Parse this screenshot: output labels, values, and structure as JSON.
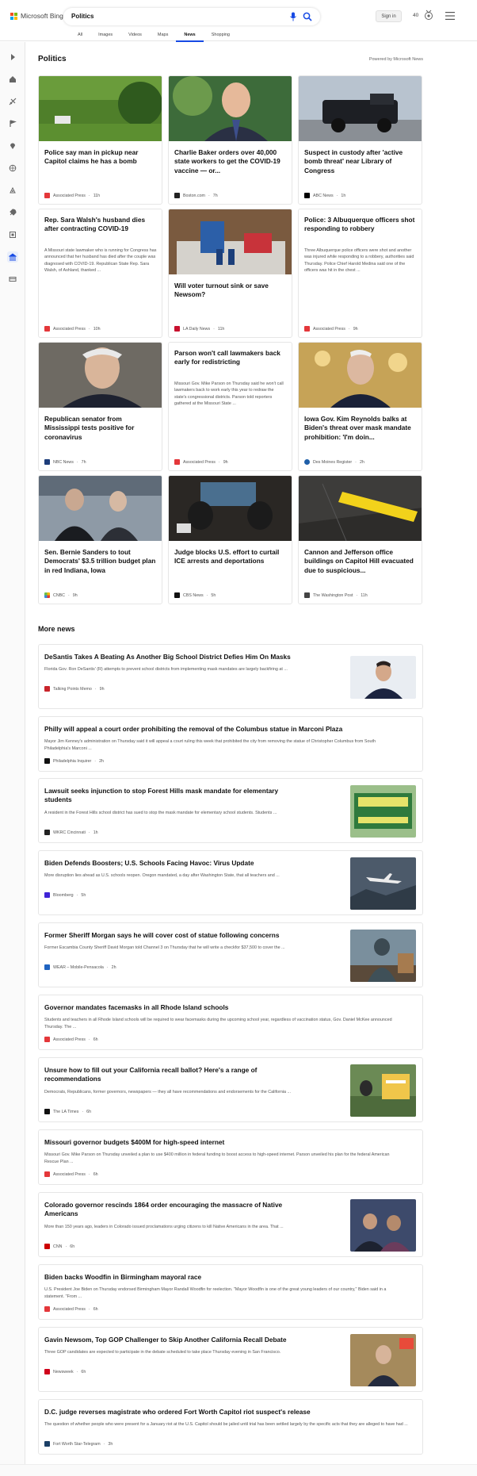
{
  "header": {
    "brand": "Microsoft Bing",
    "query": "Politics",
    "signin": "Sign in",
    "points": "40",
    "tabs": [
      "All",
      "Images",
      "Videos",
      "Maps",
      "News",
      "Shopping"
    ],
    "active_tab": "News",
    "logo_colors": [
      "#f25022",
      "#7fba00",
      "#00a4ef",
      "#ffb900"
    ],
    "accent": "#174ae4"
  },
  "rail": {
    "icons": [
      "expand-icon",
      "home-icon",
      "sports-icon",
      "flag-icon",
      "location-icon",
      "globe-icon",
      "science-icon",
      "rocket-icon",
      "entertainment-icon",
      "politics-icon",
      "money-icon"
    ]
  },
  "section": {
    "title": "Politics",
    "powered": "Powered by Microsoft News"
  },
  "cards": [
    {
      "title": "Police say man in pickup near Capitol claims he has a bomb",
      "source": "Associated Press",
      "time": "11h"
    },
    {
      "title": "Charlie Baker orders over 40,000 state workers to get the COVID-19 vaccine — or...",
      "source": "Boston.com",
      "time": "7h"
    },
    {
      "title": "Suspect in custody after 'active bomb threat' near Library of Congress",
      "source": "ABC News",
      "time": "1h"
    },
    {
      "title": "Rep. Sara Walsh's husband dies after contracting COVID-19",
      "snippet": "A Missouri state lawmaker who is running for Congress has announced that her husband has died after the couple was diagnosed with COVID-19. Republican State Rep. Sara Walsh, of Ashland, thanked ...",
      "source": "Associated Press",
      "time": "10h"
    },
    {
      "title": "Will voter turnout sink or save Newsom?",
      "source": "LA Daily News",
      "time": "11h"
    },
    {
      "title": "Police: 3 Albuquerque officers shot responding to robbery",
      "snippet": "Three Albuquerque police officers were shot and another was injured while responding to a robbery, authorities said Thursday. Police Chief Harold Medina said one of the officers was hit in the chest ...",
      "source": "Associated Press",
      "time": "9h"
    },
    {
      "title": "Republican senator from Mississippi tests positive for coronavirus",
      "source": "NBC News",
      "time": "7h"
    },
    {
      "title": "Parson won't call lawmakers back early for redistricting",
      "snippet": "Missouri Gov. Mike Parson on Thursday said he won't call lawmakers back to work early this year to redraw the state's congressional districts. Parson told reporters gathered at the Missouri State ...",
      "source": "Associated Press",
      "time": "9h"
    },
    {
      "title": "Iowa Gov. Kim Reynolds balks at Biden's threat over mask mandate prohibition: 'I'm doin...",
      "source": "Des Moines Register",
      "time": "2h"
    },
    {
      "title": "Sen. Bernie Sanders to tout Democrats' $3.5 trillion budget plan in red Indiana, Iowa",
      "source": "CNBC",
      "time": "9h"
    },
    {
      "title": "Judge blocks U.S. effort to curtail ICE arrests and deportations",
      "source": "CBS News",
      "time": "5h"
    },
    {
      "title": "Cannon and Jefferson office buildings on Capitol Hill evacuated due to suspicious...",
      "source": "The Washington Post",
      "time": "11h"
    }
  ],
  "more": {
    "title": "More news",
    "items": [
      {
        "title": "DeSantis Takes A Beating As Another Big School District Defies Him On Masks",
        "snippet": "Florida Gov. Ron DeSantis' (R) attempts to prevent school districts from implementing mask mandates are largely backfiring at ...",
        "source": "Talking Points Memo",
        "time": "9h"
      },
      {
        "title": "Philly will appeal a court order prohibiting the removal of the Columbus statue in Marconi Plaza",
        "snippet": "Mayor Jim Kenney's administration on Thursday said it will appeal a court ruling this week that prohibited the city from removing the statue of Christopher Columbus from South Philadelphia's Marconi ...",
        "source": "Philadelphia Inquirer",
        "time": "2h"
      },
      {
        "title": "Lawsuit seeks injunction to stop Forest Hills mask mandate for elementary students",
        "snippet": "A resident in the Forest Hills school district has sued to stop the mask mandate for elementary school students. Students ...",
        "source": "WKRC Cincinnati",
        "time": "1h"
      },
      {
        "title": "Biden Defends Boosters; U.S. Schools Facing Havoc: Virus Update",
        "snippet": "More disruption lies ahead as U.S. schools reopen. Oregon mandated, a day after Washington State, that all teachers and ...",
        "source": "Bloomberg",
        "time": "5h"
      },
      {
        "title": "Former Sheriff Morgan says he will cover cost of statue following concerns",
        "snippet": "Former Escambia County Sheriff David Morgan told Channel 3 on Thursday that he will write a checkfor $37,500 to cover the ...",
        "source": "WEAR – Mobile-Pensacola",
        "time": "2h"
      },
      {
        "title": "Governor mandates facemasks in all Rhode Island schools",
        "snippet": "Students and teachers in all Rhode Island schools will be required to wear facemasks during the upcoming school year, regardless of vaccination status, Gov. Daniel McKee announced Thursday. The ...",
        "source": "Associated Press",
        "time": "6h"
      },
      {
        "title": "Unsure how to fill out your California recall ballot? Here's a range of recommendations",
        "snippet": "Democrats, Republicans, former governors, newspapers — they all have recommendations and endorsements for the California ...",
        "source": "The LA Times",
        "time": "6h"
      },
      {
        "title": "Missouri governor budgets $400M for high-speed internet",
        "snippet": "Missouri Gov. Mike Parson on Thursday unveiled a plan to use $400 million in federal funding to boost access to high-speed internet. Parson unveiled his plan for the federal American Rescue Plan ...",
        "source": "Associated Press",
        "time": "6h"
      },
      {
        "title": "Colorado governor rescinds 1864 order encouraging the massacre of Native Americans",
        "snippet": "More than 150 years ago, leaders in Colorado issued proclamations urging citizens to kill Native Americans in the area. That ...",
        "source": "CNN",
        "time": "6h"
      },
      {
        "title": "Biden backs Woodfin in Birmingham mayoral race",
        "snippet": "U.S. President Joe Biden on Thursday endorsed Birmingham Mayor Randall Woodfin for reelection. \"Mayor Woodfin is one of the great young leaders of our country,\" Biden said in a statement. \"From ...",
        "source": "Associated Press",
        "time": "6h"
      },
      {
        "title": "Gavin Newsom, Top GOP Challenger to Skip Another California Recall Debate",
        "snippet": "Three GOP candidates are expected to participate in the debate scheduled to take place Thursday evening in San Francisco.",
        "source": "Newsweek",
        "time": "6h"
      },
      {
        "title": "D.C. judge reverses magistrate who ordered Fort Worth Capitol riot suspect's release",
        "snippet": "The question of whether people who were present for a January riot at the U.S. Capitol should be jailed until trial has been settled largely by the specific acts that they are alleged to have had ...",
        "source": "Fort Worth Star-Telegram",
        "time": "3h"
      }
    ]
  }
}
